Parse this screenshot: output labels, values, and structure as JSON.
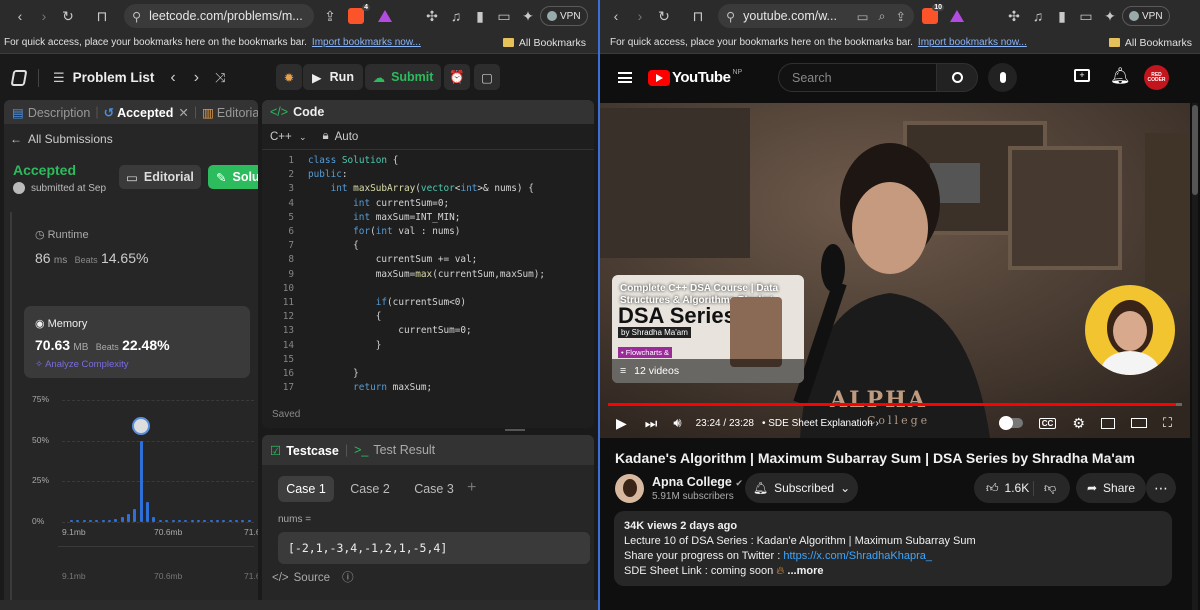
{
  "left_browser": {
    "url": "leetcode.com/problems/m...",
    "brave_badge": "4",
    "vpn_label": "VPN",
    "bookmarks_prompt": "For quick access, place your bookmarks here on the bookmarks bar.",
    "import_link": "Import bookmarks now...",
    "all_bookmarks": "All Bookmarks"
  },
  "right_browser": {
    "url": "youtube.com/w...",
    "brave_badge": "10",
    "vpn_label": "VPN",
    "bookmarks_prompt": "For quick access, place your bookmarks here on the bookmarks bar.",
    "import_link": "Import bookmarks now...",
    "all_bookmarks": "All Bookmarks"
  },
  "leetcode": {
    "problem_list": "Problem List",
    "run": "Run",
    "submit": "Submit",
    "tabs": {
      "description": "Description",
      "accepted": "Accepted",
      "editorial": "Editorial"
    },
    "all_submissions": "All Submissions",
    "status": "Accepted",
    "submitted_at": "submitted at Sep",
    "editorial_btn": "Editorial",
    "solution_btn": "Solu",
    "runtime": {
      "label": "Runtime",
      "value": "86",
      "unit": "ms",
      "beats_label": "Beats",
      "beats": "14.65%"
    },
    "memory": {
      "label": "Memory",
      "value": "70.63",
      "unit": "MB",
      "beats_label": "Beats",
      "beats": "22.48%"
    },
    "analyze": "Analyze Complexity",
    "chart_data": {
      "type": "bar",
      "yticks": [
        "75%",
        "50%",
        "25%",
        "0%"
      ],
      "xticks": [
        "9.1mb",
        "70.6mb",
        "71.6"
      ],
      "ylim": [
        0,
        75
      ],
      "values": [
        0.6,
        0.6,
        0.6,
        0.6,
        0.6,
        0.6,
        0.6,
        2,
        3,
        5,
        8,
        50,
        12,
        3,
        1,
        0.6,
        0.6,
        0.6,
        0.6,
        0.6,
        0.6,
        0.6,
        0.6,
        0.6,
        0.6,
        0.6,
        0.6,
        0.6,
        0.6
      ],
      "highlight_index": 11
    },
    "code_panel": {
      "title": "Code",
      "language": "C++",
      "mode": "Auto",
      "saved": "Saved",
      "lines": [
        "class Solution {",
        "public:",
        "    int maxSubArray(vector<int>& nums) {",
        "        int currentSum=0;",
        "        int maxSum=INT_MIN;",
        "        for(int val : nums)",
        "        {",
        "            currentSum += val;",
        "            maxSum=max(currentSum,maxSum);",
        "",
        "            if(currentSum<0)",
        "            {",
        "                currentSum=0;",
        "            }",
        "",
        "        }",
        "        return maxSum;"
      ],
      "line_numbers": [
        "1",
        "2",
        "3",
        "4",
        "5",
        "6",
        "7",
        "8",
        "9",
        "10",
        "11",
        "12",
        "13",
        "14",
        "15",
        "16",
        "17"
      ]
    },
    "testcase": {
      "tab": "Testcase",
      "result_tab": "Test Result",
      "cases": [
        "Case 1",
        "Case 2",
        "Case 3"
      ],
      "param": "nums =",
      "value": "[-2,1,-3,4,-1,2,1,-5,4]",
      "source": "Source"
    }
  },
  "youtube": {
    "logo": "YouTube",
    "region": "NP",
    "search_placeholder": "Search",
    "channel_badge": "RED CODER",
    "overlay": {
      "title": "Complete C++ DSA Course | Data Structures & Algorithms Playlist",
      "big": "DSA Series",
      "by": "by Shradha Ma'am",
      "bullet": "• Flowcharts &",
      "count": "12 videos"
    },
    "video_text": "ALPHA",
    "video_text2": "College",
    "time": "23:24 / 23:28",
    "chapter": "SDE Sheet Explanation",
    "progress": 0.99,
    "title": "Kadane's Algorithm | Maximum Subarray Sum | DSA Series by Shradha Ma'am",
    "channel": "Apna College",
    "subscribers": "5.91M subscribers",
    "subscribed": "Subscribed",
    "likes": "1.6K",
    "share": "Share",
    "description": {
      "stats": "34K views  2 days ago",
      "line1": "Lecture 10 of DSA Series : Kadan'e Algorithm | Maximum Subarray Sum",
      "line2_prefix": "Share your progress on Twitter : ",
      "line2_link": "https://x.com/ShradhaKhapra_",
      "line3": "SDE Sheet Link : coming soon",
      "more": "...more"
    }
  }
}
